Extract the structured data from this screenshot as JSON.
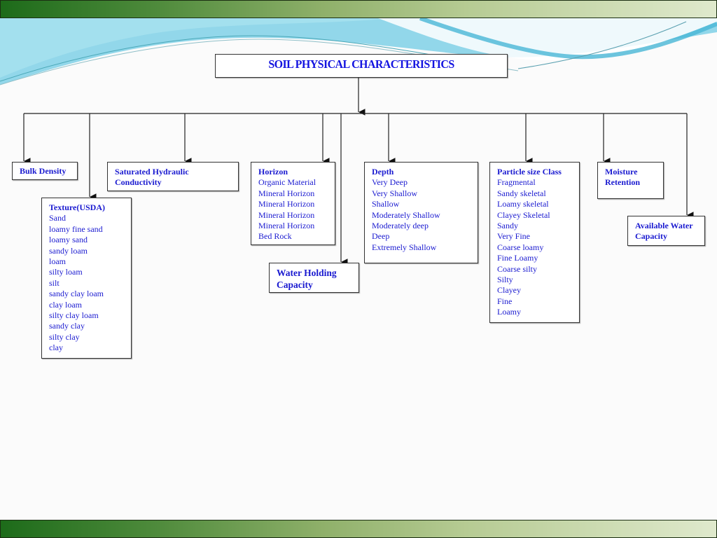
{
  "title": "SOIL PHYSICAL CHARACTERISTICS",
  "colors": {
    "text": "#1a1ad0",
    "title": "#1414e0",
    "bar_dark": "#1d6b1a",
    "bar_light": "#dfe9cc",
    "swoosh": "#5fc4dc"
  },
  "nodes": {
    "bulk_density": {
      "head": "Bulk Density",
      "items": []
    },
    "saturated_hydraulic": {
      "head": "Saturated  Hydraulic Conductivity",
      "items": []
    },
    "texture": {
      "head": "Texture(USDA)",
      "items": [
        "Sand",
        "loamy fine sand",
        "loamy sand",
        "sandy loam",
        "loam",
        "silty loam",
        "silt",
        "sandy clay loam",
        "clay loam",
        "silty clay loam",
        "sandy clay",
        "silty clay",
        "clay"
      ]
    },
    "horizon": {
      "head": "Horizon",
      "items": [
        "Organic Material",
        "Mineral Horizon",
        "Mineral Horizon",
        "Mineral Horizon",
        "Mineral Horizon",
        "Bed Rock"
      ]
    },
    "water_holding": {
      "head": "Water Holding Capacity",
      "items": []
    },
    "depth": {
      "head": "Depth",
      "items": [
        "Very Deep",
        "Very Shallow",
        "Shallow",
        "Moderately Shallow",
        "Moderately deep",
        "Deep",
        "Extremely Shallow"
      ]
    },
    "particle_size": {
      "head": "Particle size Class",
      "items": [
        "Fragmental",
        "Sandy skeletal",
        "Loamy skeletal",
        "Clayey Skeletal",
        "Sandy",
        "Very Fine",
        "Coarse loamy",
        "Fine Loamy",
        "Coarse silty",
        "Silty",
        "Clayey",
        "Fine",
        "Loamy"
      ]
    },
    "moisture_retention": {
      "head": "Moisture Retention",
      "items": []
    },
    "available_water": {
      "head": "Available Water Capacity",
      "items": []
    }
  }
}
